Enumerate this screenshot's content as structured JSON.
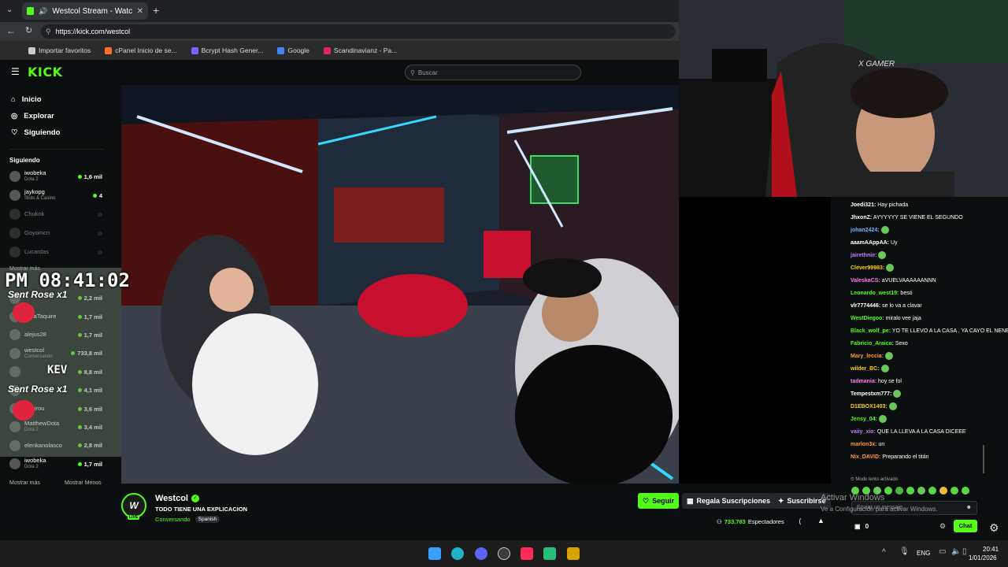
{
  "browser": {
    "tab_title": "Westcol Stream - Watch Live",
    "url": "https://kick.com/westcol",
    "bookmarks": [
      {
        "label": "Importar favoritos",
        "color": "#cccccc"
      },
      {
        "label": "cPanel Inicio de se...",
        "color": "#ff6c2c"
      },
      {
        "label": "Bcrypt Hash Gener...",
        "color": "#7b61ff"
      },
      {
        "label": "Google",
        "color": "#4285f4"
      },
      {
        "label": "Scandinavianz - Pa...",
        "color": "#e0245e"
      }
    ]
  },
  "kick": {
    "logo": "KICK",
    "search_placeholder": "Buscar",
    "nav": [
      {
        "label": "Inicio",
        "icon": "home-icon"
      },
      {
        "label": "Explorar",
        "icon": "compass-icon"
      },
      {
        "label": "Siguiendo",
        "icon": "heart-icon"
      }
    ],
    "following_title": "Siguiendo",
    "following": [
      {
        "name": "iwobeka",
        "sub": "Dota 2",
        "viewers": "1,6 mil",
        "online": true
      },
      {
        "name": "jaykopg",
        "sub": "Slots & Casino",
        "viewers": "4",
        "online": true
      },
      {
        "name": "Chuknk",
        "sub": "",
        "viewers": "",
        "online": false
      },
      {
        "name": "Goyomcn",
        "sub": "",
        "viewers": "",
        "online": false
      },
      {
        "name": "Lucardas",
        "sub": "",
        "viewers": "",
        "online": false
      }
    ],
    "show_more": "Mostrar más",
    "recommended": [
      {
        "name": "",
        "sub": "",
        "viewers": "2,2 mil"
      },
      {
        "name": "nielaTaquire",
        "sub": "",
        "viewers": "1,7 mil"
      },
      {
        "name": "alejus28",
        "sub": "",
        "viewers": "1,7 mil"
      },
      {
        "name": "westcol",
        "sub": "Conversando",
        "viewers": "733,8 mil"
      },
      {
        "name": "",
        "sub": "",
        "viewers": "8,8 mil"
      },
      {
        "name": "",
        "sub": "",
        "viewers": "4,1 mil"
      },
      {
        "name": "ramirou",
        "sub": "",
        "viewers": "3,6 mil"
      },
      {
        "name": "MatthewDota",
        "sub": "Dota 2",
        "viewers": "3,4 mil"
      },
      {
        "name": "elenkanolasco",
        "sub": "",
        "viewers": "2,8 mil"
      },
      {
        "name": "iwobeka",
        "sub": "Dota 2",
        "viewers": "1,7 mil"
      }
    ],
    "show_more2": "Mostrar más",
    "show_less": "Mostrar Menos"
  },
  "overlay": {
    "clock": "PM 08:41:02",
    "gift1": "Sent Rose x1",
    "gift_user": "KEV",
    "gift2": "Sent Rose x1"
  },
  "stream": {
    "channel": "Westcol",
    "title": "TODO TIENE UNA EXPLICACION",
    "category": "Conversando",
    "language": "Spanish",
    "live_badge": "LIVE",
    "viewers": "733.763",
    "viewers_label": "Espectadores",
    "follow": "Seguir",
    "gift_subs": "Regala Suscripciones",
    "subscribe": "Suscribirse",
    "watermark1": "Activar Windows",
    "watermark2": "Ve a Configuración para activar Windows."
  },
  "chat": {
    "messages": [
      {
        "user": "Joedi321:",
        "text": "Hay pichada",
        "color": "#ffffff"
      },
      {
        "user": "JhxonZ:",
        "text": "AYYYYYY SE VIENE EL SEGUNDO",
        "color": "#ffffff"
      },
      {
        "user": "johan2424:",
        "text": "",
        "color": "#7ab3ff"
      },
      {
        "user": "aaamAAppAA:",
        "text": "Uy",
        "color": "#ffffff"
      },
      {
        "user": "jairethnie:",
        "text": "",
        "color": "#c37dff"
      },
      {
        "user": "Clever99983:",
        "text": "",
        "color": "#ffcc00"
      },
      {
        "user": "ValeskaCS:",
        "text": "aVUELVAAAAAANNN",
        "color": "#ff7de9"
      },
      {
        "user": "Leonardo_west19:",
        "text": "besó",
        "color": "#53fc18"
      },
      {
        "user": "vlr7774446:",
        "text": "se lo va a clavar",
        "color": "#ffffff"
      },
      {
        "user": "WestDiegoo:",
        "text": "miralo vee jaja",
        "color": "#53fc18"
      },
      {
        "user": "Black_wolf_pe:",
        "text": "YO TE LLEVO A LA CASA . YA CAYO EL NENE",
        "color": "#53fc18"
      },
      {
        "user": "Fabricio_Araica:",
        "text": "Sexo",
        "color": "#53fc18"
      },
      {
        "user": "Mary_leccia:",
        "text": "",
        "color": "#ff9a3c"
      },
      {
        "user": "wilder_BC:",
        "text": "",
        "color": "#ffcc00"
      },
      {
        "user": "tadmania:",
        "text": "hoy se fol",
        "color": "#ff7de9"
      },
      {
        "user": "Tempestxm777:",
        "text": "",
        "color": "#ffffff"
      },
      {
        "user": "D1EBOX1403:",
        "text": "",
        "color": "#ffcc00"
      },
      {
        "user": "Jensy_04:",
        "text": "",
        "color": "#53fc18"
      },
      {
        "user": "vaiiy_xio:",
        "text": "QUE LA LLEVA A LA CASA DICEEE",
        "color": "#c37dff"
      },
      {
        "user": "marlon3x:",
        "text": "un",
        "color": "#ff9a3c"
      },
      {
        "user": "Nix_DAVID:",
        "text": "Preparando el titán",
        "color": "#ff9a3c"
      }
    ],
    "slow_mode": "Modo lento activado",
    "input_placeholder": "Enviar un mensaje",
    "points": "0",
    "chat_button": "Chat"
  },
  "taskbar": {
    "lang": "ENG",
    "time": "20:41",
    "date": "1/01/2026"
  },
  "colors": {
    "accent": "#53fc18"
  }
}
